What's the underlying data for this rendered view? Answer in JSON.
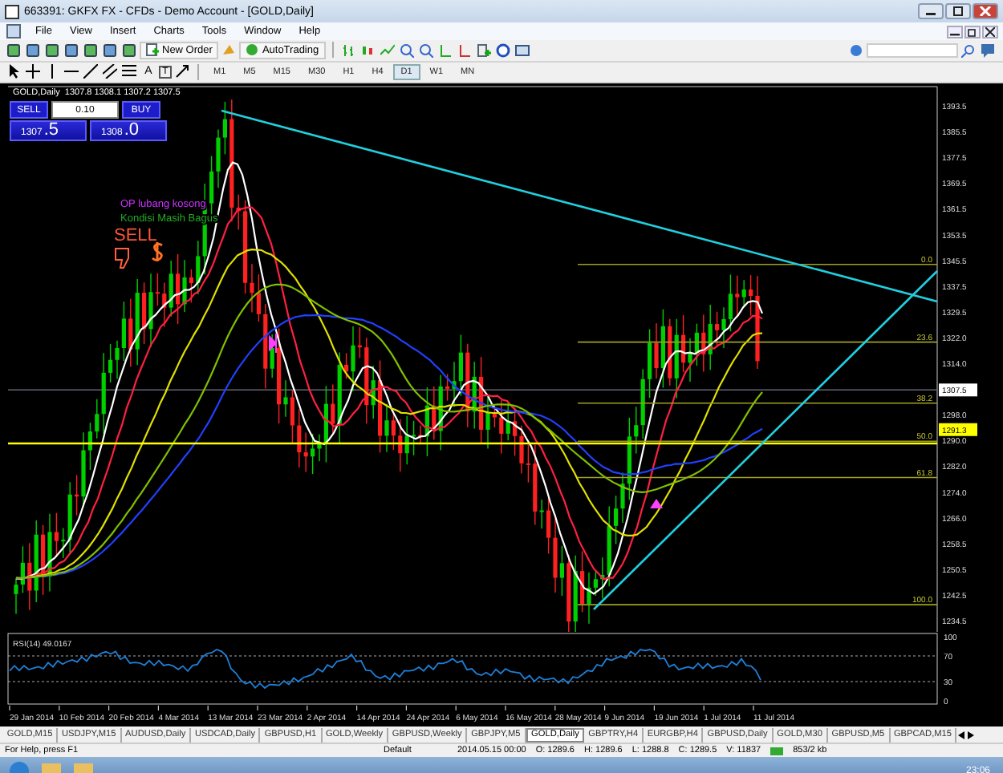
{
  "window": {
    "title": "663391: GKFX FX - CFDs - Demo Account - [GOLD,Daily]"
  },
  "menu": [
    "File",
    "View",
    "Insert",
    "Charts",
    "Tools",
    "Window",
    "Help"
  ],
  "toolbar": {
    "new_order": "New Order",
    "autotrading": "AutoTrading",
    "text_tools": [
      "A",
      "T"
    ]
  },
  "timeframes": [
    {
      "label": "M1",
      "selected": false
    },
    {
      "label": "M5",
      "selected": false
    },
    {
      "label": "M15",
      "selected": false
    },
    {
      "label": "M30",
      "selected": false
    },
    {
      "label": "H1",
      "selected": false
    },
    {
      "label": "H4",
      "selected": false
    },
    {
      "label": "D1",
      "selected": true
    },
    {
      "label": "W1",
      "selected": false
    },
    {
      "label": "MN",
      "selected": false
    }
  ],
  "chart": {
    "header": "GOLD,Daily  1307.8 1308.1 1307.2 1307.5",
    "trade_panel": {
      "sell": "SELL",
      "buy": "BUY",
      "lots": "0.10",
      "bid_big": "1307",
      "bid_small": ".5",
      "ask_big": "1308",
      "ask_small": ".0"
    },
    "notes": [
      {
        "text": "OP lubang kosong",
        "color": "#cc33ff"
      },
      {
        "text": "Kondisi Masih Bagus",
        "color": "#22aa22"
      },
      {
        "text": "SELL",
        "color": "#ff5533"
      }
    ],
    "price_axis": [
      "1393.5",
      "1385.5",
      "1377.5",
      "1369.5",
      "1361.5",
      "1353.5",
      "1345.5",
      "1337.5",
      "1329.5",
      "1322.0",
      "1314.0",
      "1298.0",
      "1290.0",
      "1282.0",
      "1274.0",
      "1266.0",
      "1258.5",
      "1250.5",
      "1242.5",
      "1234.5"
    ],
    "current_price": "1307.5",
    "line_price": "1291.3",
    "fib_levels": [
      "0.0",
      "23.6",
      "38.2",
      "50.0",
      "61.8",
      "100.0"
    ]
  },
  "indicator": {
    "label": "RSI(14) 49.0167",
    "axis": [
      "100",
      "70",
      "30",
      "0"
    ]
  },
  "dates": [
    "29 Jan 2014",
    "10 Feb 2014",
    "20 Feb 2014",
    "4 Mar 2014",
    "13 Mar 2014",
    "23 Mar 2014",
    "2 Apr 2014",
    "14 Apr 2014",
    "24 Apr 2014",
    "6 May 2014",
    "16 May 2014",
    "28 May 2014",
    "9 Jun 2014",
    "19 Jun 2014",
    "1 Jul 2014",
    "11 Jul 2014"
  ],
  "tabs": [
    {
      "label": "GOLD,M15",
      "selected": false
    },
    {
      "label": "USDJPY,M15",
      "selected": false
    },
    {
      "label": "AUDUSD,Daily",
      "selected": false
    },
    {
      "label": "USDCAD,Daily",
      "selected": false
    },
    {
      "label": "GBPUSD,H1",
      "selected": false
    },
    {
      "label": "GOLD,Weekly",
      "selected": false
    },
    {
      "label": "GBPUSD,Weekly",
      "selected": false
    },
    {
      "label": "GBPJPY,M5",
      "selected": false
    },
    {
      "label": "GOLD,Daily",
      "selected": true
    },
    {
      "label": "GBPTRY,H4",
      "selected": false
    },
    {
      "label": "EURGBP,H4",
      "selected": false
    },
    {
      "label": "GBPUSD,Daily",
      "selected": false
    },
    {
      "label": "GOLD,M30",
      "selected": false
    },
    {
      "label": "GBPUSD,M5",
      "selected": false
    },
    {
      "label": "GBPCAD,M15",
      "selected": false
    }
  ],
  "status_bar": {
    "help": "For Help, press F1",
    "profile": "Default",
    "fields": [
      "2014.05.15 00:00",
      "O: 1289.6",
      "H: 1289.6",
      "L: 1288.8",
      "C: 1289.5",
      "V: 11837"
    ],
    "traffic": "853/2 kb"
  },
  "taskbar": {
    "time": "23:06"
  }
}
